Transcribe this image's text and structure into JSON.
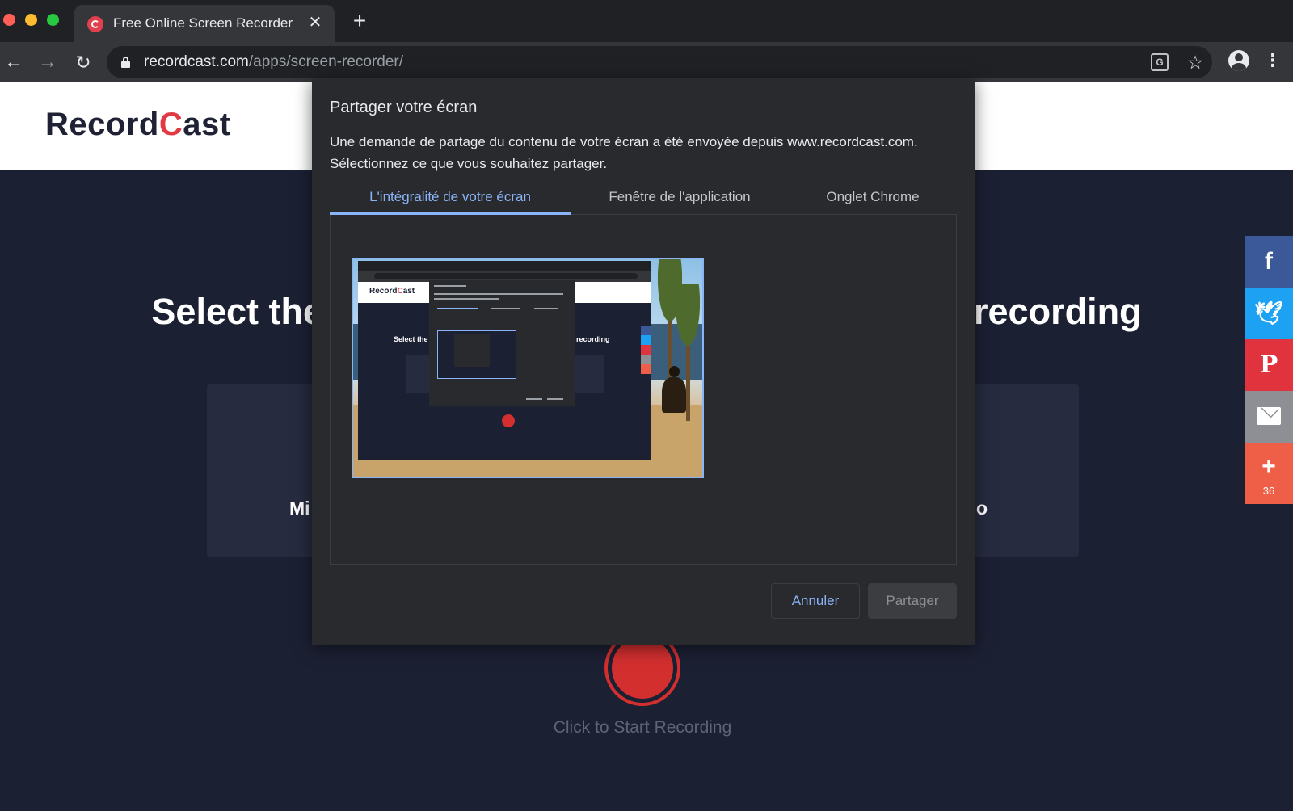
{
  "browser": {
    "tab_title": "Free Online Screen Recorder -",
    "tab_close": "✕",
    "new_tab": "+",
    "url_host": "recordcast.com",
    "url_path": "/apps/screen-recorder/",
    "icons": [
      "back-arrow-icon",
      "forward-arrow-icon",
      "reload-icon",
      "lock-icon",
      "translate-icon",
      "star-icon",
      "profile-icon",
      "menu-icon"
    ]
  },
  "site": {
    "logo_part1": "Record",
    "logo_c": "C",
    "logo_part2": "ast",
    "heading_left": "Select the",
    "heading_right": "recording",
    "card_left_label": "Mi",
    "card_right_label": "o",
    "record_label": "Click to Start Recording",
    "brand_color": "#e23a44",
    "record_color": "#d32f2f"
  },
  "share_bar": {
    "items": [
      {
        "name": "facebook",
        "glyph": "f",
        "color": "#3b5998"
      },
      {
        "name": "twitter",
        "glyph": "🐦",
        "color": "#1da1f2"
      },
      {
        "name": "pinterest",
        "glyph": "P",
        "color": "#e0333d"
      },
      {
        "name": "email",
        "glyph": "",
        "color": "#8d8f95"
      },
      {
        "name": "more",
        "glyph": "+",
        "color": "#ef5e47"
      }
    ],
    "share_count": "36"
  },
  "dialog": {
    "title": "Partager votre écran",
    "description_line1": "Une demande de partage du contenu de votre écran a été envoyée depuis www.recordcast.com.",
    "description_line2": "Sélectionnez ce que vous souhaitez partager.",
    "tabs": [
      {
        "label": "L'intégralité de votre écran",
        "active": true
      },
      {
        "label": "Fenêtre de l'application",
        "active": false
      },
      {
        "label": "Onglet Chrome",
        "active": false
      }
    ],
    "cancel_label": "Annuler",
    "share_label": "Partager",
    "accent_color": "#8ab4f8"
  }
}
